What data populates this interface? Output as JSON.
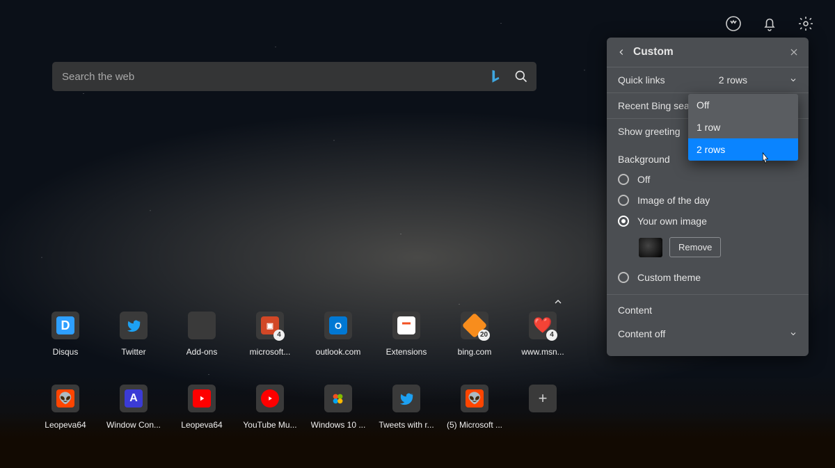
{
  "search": {
    "placeholder": "Search the web"
  },
  "topbar_icons": [
    "rewards-icon",
    "notifications-icon",
    "settings-icon"
  ],
  "tiles": [
    {
      "label": "Disqus",
      "icon": "disqus",
      "badge": null
    },
    {
      "label": "Twitter",
      "icon": "twitter",
      "badge": null
    },
    {
      "label": "Add-ons",
      "icon": "addons",
      "badge": null
    },
    {
      "label": "microsoft...",
      "icon": "ppt",
      "badge": "4"
    },
    {
      "label": "outlook.com",
      "icon": "outlook",
      "badge": null
    },
    {
      "label": "Extensions",
      "icon": "ext",
      "badge": null
    },
    {
      "label": "bing.com",
      "icon": "bing",
      "badge": "20"
    },
    {
      "label": "www.msn...",
      "icon": "msn",
      "badge": "4"
    },
    {
      "label": "Leopeva64",
      "icon": "reddit",
      "badge": null
    },
    {
      "label": "Window Con...",
      "icon": "A",
      "badge": null
    },
    {
      "label": "Leopeva64",
      "icon": "yt",
      "badge": null
    },
    {
      "label": "YouTube Mu...",
      "icon": "ytcircle",
      "badge": null
    },
    {
      "label": "Windows 10 ...",
      "icon": "win",
      "badge": null
    },
    {
      "label": "Tweets with r...",
      "icon": "twitter",
      "badge": null
    },
    {
      "label": "(5) Microsoft ...",
      "icon": "reddit",
      "badge": null
    }
  ],
  "panel": {
    "title": "Custom",
    "rows": {
      "quick_links": "Quick links",
      "quick_links_value": "2 rows",
      "recent_bing": "Recent Bing search",
      "show_greeting": "Show greeting",
      "background": "Background",
      "bg_off": "Off",
      "bg_iotd": "Image of the day",
      "bg_own": "Your own image",
      "remove": "Remove",
      "custom_theme": "Custom theme",
      "content": "Content",
      "content_off": "Content off"
    },
    "dropdown_options": [
      "Off",
      "1 row",
      "2 rows"
    ],
    "dropdown_selected": "2 rows"
  }
}
